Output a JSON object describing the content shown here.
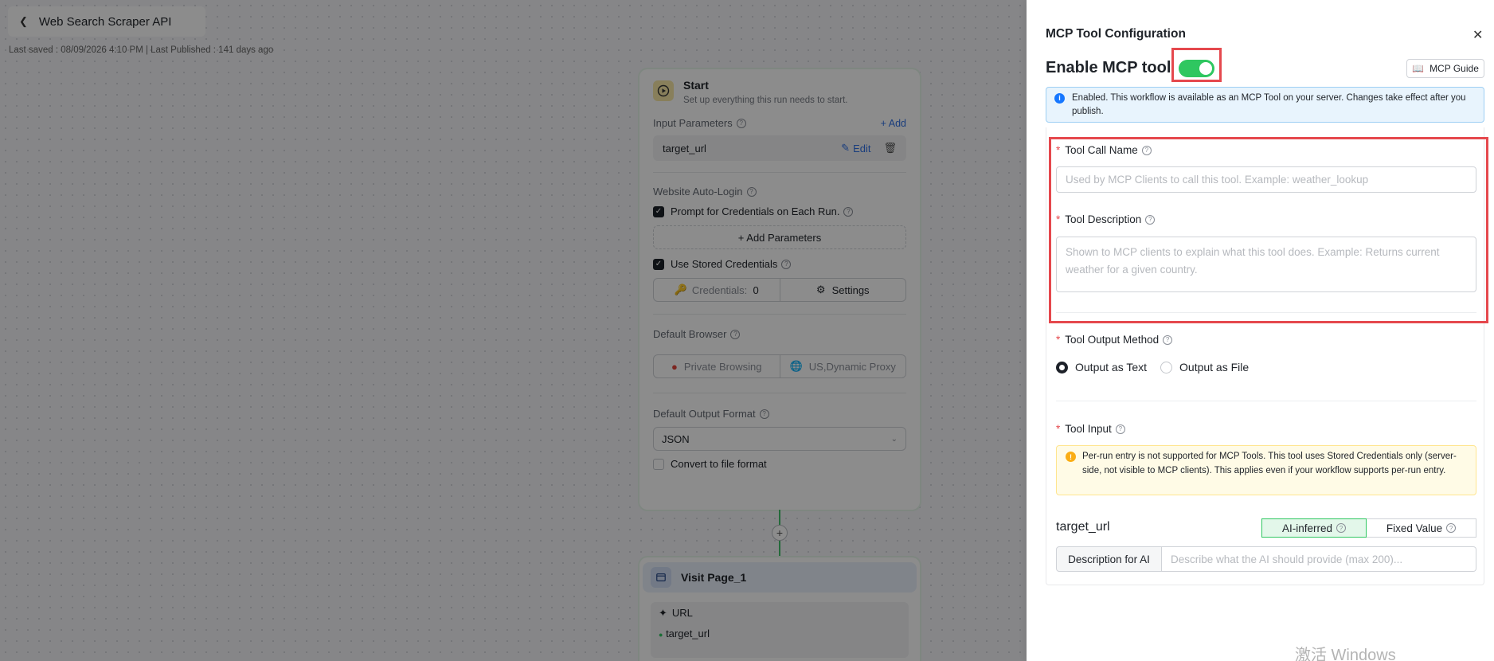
{
  "header": {
    "back_label": "Web Search Scraper API",
    "saved_info": "Last saved : 08/09/2026 4:10 PM | Last Published : 141 days ago"
  },
  "start_node": {
    "title": "Start",
    "subtitle": "Set up everything this run needs to start.",
    "input_params_label": "Input Parameters",
    "add_label": "+ Add",
    "param_name": "target_url",
    "edit_label": "Edit",
    "auto_login_label": "Website Auto-Login",
    "prompt_credentials_label": "Prompt for Credentials on Each Run.",
    "add_parameters_label": "+ Add Parameters",
    "stored_credentials_label": "Use Stored Credentials",
    "credentials_label": "Credentials:",
    "credentials_count": "0",
    "settings_label": "Settings",
    "default_browser_label": "Default Browser",
    "browser_private": "Private Browsing",
    "browser_proxy": "US,Dynamic Proxy",
    "default_output_label": "Default Output Format",
    "output_format": "JSON",
    "convert_label": "Convert to file format"
  },
  "visit_node": {
    "title": "Visit Page_1",
    "url_label": "URL",
    "url_value": "target_url"
  },
  "panel": {
    "title": "MCP Tool Configuration",
    "enable_label": "Enable MCP tool",
    "enabled": true,
    "guide_label": "MCP Guide",
    "info_text": "Enabled. This workflow is available as an MCP Tool on your server. Changes take effect after you publish.",
    "tool_call_name_label": "Tool Call Name",
    "tool_call_name_placeholder": "Used by MCP Clients to call this tool. Example: weather_lookup",
    "tool_description_label": "Tool Description",
    "tool_description_placeholder": "Shown to MCP clients to explain what this tool does. Example: Returns current weather for a given country.",
    "output_method_label": "Tool Output Method",
    "output_text_label": "Output as Text",
    "output_file_label": "Output as File",
    "tool_input_label": "Tool Input",
    "warning_text": "Per-run entry is not supported for MCP Tools. This tool uses Stored Credentials only (server-side, not visible to MCP clients). This applies even if your workflow supports per-run entry.",
    "input_param_name": "target_url",
    "ai_inferred_label": "AI-inferred",
    "fixed_value_label": "Fixed Value",
    "desc_ai_label": "Description for AI",
    "desc_ai_placeholder": "Describe what the AI should provide (max 200)..."
  },
  "watermark": "激活 Windows",
  "colors": {
    "accent_green": "#2fc760",
    "link_blue": "#2f6fe4",
    "highlight_red": "#e5484d",
    "info_blue": "#1677ff",
    "warning_yellow": "#faad14"
  }
}
